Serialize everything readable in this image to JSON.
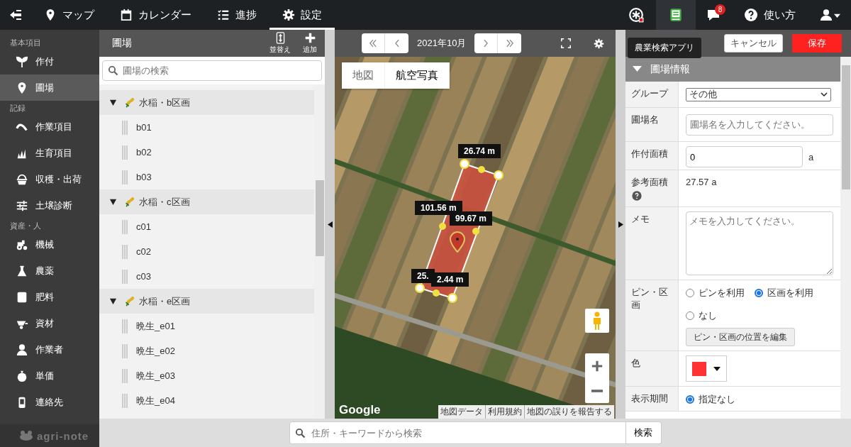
{
  "top_nav": {
    "tabs": [
      {
        "label": "マップ",
        "selected": false
      },
      {
        "label": "カレンダー",
        "selected": false
      },
      {
        "label": "進捗",
        "selected": false
      },
      {
        "label": "設定",
        "selected": true
      }
    ],
    "app_buttons": [
      {
        "selected": false
      },
      {
        "selected": true
      }
    ],
    "notification_badge": "8",
    "help_label": "使い方",
    "tooltip": "農業検索アプリ"
  },
  "sidebar": {
    "sections": [
      {
        "heading": "基本項目",
        "items": [
          {
            "label": "作付",
            "selected": false
          },
          {
            "label": "圃場",
            "selected": true
          }
        ]
      },
      {
        "heading": "記録",
        "items": [
          {
            "label": "作業項目",
            "selected": false
          },
          {
            "label": "生育項目",
            "selected": false
          },
          {
            "label": "収穫・出荷",
            "selected": false
          },
          {
            "label": "土壌診断",
            "selected": false
          }
        ]
      },
      {
        "heading": "資産・人",
        "items": [
          {
            "label": "機械",
            "selected": false
          },
          {
            "label": "農薬",
            "selected": false
          },
          {
            "label": "肥料",
            "selected": false
          },
          {
            "label": "資材",
            "selected": false
          },
          {
            "label": "作業者",
            "selected": false
          },
          {
            "label": "単価",
            "selected": false
          },
          {
            "label": "連絡先",
            "selected": false
          }
        ]
      }
    ],
    "logo": "agri-note"
  },
  "field_list": {
    "title": "圃場",
    "actions": [
      {
        "label": "並替え"
      },
      {
        "label": "追加"
      }
    ],
    "search": {
      "placeholder": "圃場の検索"
    },
    "groups": [
      {
        "name": "水稲・b区画",
        "expanded": true,
        "children": [
          {
            "name": "b01"
          },
          {
            "name": "b02"
          },
          {
            "name": "b03"
          }
        ]
      },
      {
        "name": "水稲・c区画",
        "expanded": true,
        "children": [
          {
            "name": "c01"
          },
          {
            "name": "c02"
          },
          {
            "name": "c03"
          }
        ]
      },
      {
        "name": "水稲・e区画",
        "expanded": true,
        "children": [
          {
            "name": "晩生_e01"
          },
          {
            "name": "晩生_e02"
          },
          {
            "name": "晩生_e03"
          },
          {
            "name": "晩生_e04"
          }
        ]
      }
    ]
  },
  "map": {
    "month": "2021年10月",
    "map_types": [
      {
        "label": "地図",
        "selected": false
      },
      {
        "label": "航空写真",
        "selected": true
      }
    ],
    "measurements": [
      "26.74 m",
      "101.56 m",
      "99.67 m",
      "25.",
      "2.44 m"
    ],
    "provider": "Google",
    "attribution": [
      "地図データ",
      "利用規約",
      "地図の誤りを報告する"
    ]
  },
  "address_search": {
    "placeholder": "住所・キーワードから検索",
    "button": "検索"
  },
  "detail": {
    "buttons": [
      {
        "kind": "cancel",
        "label": "キャンセル"
      },
      {
        "kind": "save",
        "label": "保存"
      }
    ],
    "section": {
      "title": "圃場情報",
      "expanded": true
    },
    "fields": [
      {
        "kind": "select",
        "label": "グループ",
        "value": "その他"
      },
      {
        "kind": "text",
        "label": "圃場名",
        "placeholder": "圃場名を入力してください。"
      },
      {
        "kind": "number",
        "label": "作付面積",
        "value": "0",
        "unit": "a"
      },
      {
        "kind": "readout",
        "label": "参考面積",
        "value": "27.57 a",
        "help": true
      },
      {
        "kind": "textarea",
        "label": "メモ",
        "placeholder": "メモを入力してください。"
      },
      {
        "kind": "radios",
        "label": "ピン・区画",
        "options": [
          {
            "label": "ピンを利用",
            "selected": false
          },
          {
            "label": "区画を利用",
            "selected": true
          },
          {
            "label": "なし",
            "selected": false
          }
        ],
        "button": "ピン・区画の位置を編集"
      },
      {
        "kind": "color",
        "label": "色",
        "color": "#ff3333"
      },
      {
        "kind": "radios",
        "label": "表示期間",
        "options": [
          {
            "label": "指定なし",
            "selected": true
          }
        ]
      }
    ]
  }
}
